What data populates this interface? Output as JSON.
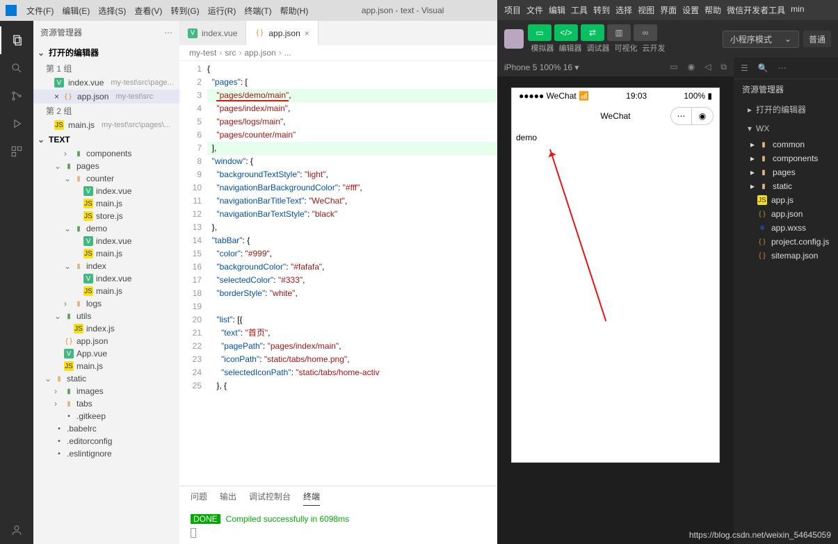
{
  "vscode": {
    "menus": [
      "文件(F)",
      "编辑(E)",
      "选择(S)",
      "查看(V)",
      "转到(G)",
      "运行(R)",
      "终端(T)",
      "帮助(H)"
    ],
    "title": "app.json - text - Visual",
    "explorer_title": "资源管理器",
    "section_open": "打开的编辑器",
    "group1": "第 1 组",
    "group2": "第 2 组",
    "open_editors": [
      {
        "icon": "vue",
        "name": "index.vue",
        "path": "my-test\\src\\page..."
      },
      {
        "icon": "json",
        "name": "app.json",
        "path": "my-test\\src",
        "sel": true,
        "pre": "×"
      },
      {
        "icon": "js",
        "name": "main.js",
        "path": "my-test\\src\\pages\\..."
      }
    ],
    "section_text": "TEXT",
    "tree": [
      {
        "d": 1,
        "chev": ">",
        "ico": "foldg",
        "t": "components"
      },
      {
        "d": 0,
        "chev": "v",
        "ico": "foldg",
        "t": "pages"
      },
      {
        "d": 1,
        "chev": "v",
        "ico": "fold",
        "t": "counter"
      },
      {
        "d": 2,
        "ico": "vue",
        "t": "index.vue"
      },
      {
        "d": 2,
        "ico": "js",
        "t": "main.js"
      },
      {
        "d": 2,
        "ico": "js",
        "t": "store.js"
      },
      {
        "d": 1,
        "chev": "v",
        "ico": "foldg",
        "t": "demo"
      },
      {
        "d": 2,
        "ico": "vue",
        "t": "index.vue"
      },
      {
        "d": 2,
        "ico": "js",
        "t": "main.js"
      },
      {
        "d": 1,
        "chev": "v",
        "ico": "fold",
        "t": "index"
      },
      {
        "d": 2,
        "ico": "vue",
        "t": "index.vue"
      },
      {
        "d": 2,
        "ico": "js",
        "t": "main.js"
      },
      {
        "d": 1,
        "chev": ">",
        "ico": "fold",
        "t": "logs"
      },
      {
        "d": 0,
        "chev": "v",
        "ico": "foldg",
        "t": "utils"
      },
      {
        "d": 1,
        "ico": "js",
        "t": "index.js"
      },
      {
        "d": 0,
        "ico": "json",
        "t": "app.json",
        "sel": true
      },
      {
        "d": 0,
        "ico": "vue",
        "t": "App.vue"
      },
      {
        "d": 0,
        "ico": "js",
        "t": "main.js"
      },
      {
        "d": -1,
        "chev": "v",
        "ico": "fold",
        "t": "static"
      },
      {
        "d": 0,
        "chev": ">",
        "ico": "foldg",
        "t": "images"
      },
      {
        "d": 0,
        "chev": ">",
        "ico": "fold",
        "t": "tabs"
      },
      {
        "d": 0,
        "ico": "",
        "t": ".gitkeep"
      },
      {
        "d": -1,
        "ico": "",
        "t": ".babelrc"
      },
      {
        "d": -1,
        "ico": "",
        "t": ".editorconfig"
      },
      {
        "d": -1,
        "ico": "",
        "t": ".eslintignore"
      }
    ],
    "tabs": [
      {
        "ico": "vue",
        "t": "index.vue"
      },
      {
        "ico": "json",
        "t": "app.json",
        "active": true
      }
    ],
    "crumbs": [
      "my-test",
      "src",
      "app.json",
      "..."
    ],
    "code": [
      {
        "n": 1,
        "h": "{"
      },
      {
        "n": 2,
        "h": "  <span class='tok-key'>\"pages\"</span>: ["
      },
      {
        "n": 3,
        "cls": "hl-add",
        "h": "    <span class='tok-str underline'>\"pages/demo/main\"</span>,"
      },
      {
        "n": 4,
        "h": "    <span class='tok-str'>\"pages/index/main\"</span>,"
      },
      {
        "n": 5,
        "h": "    <span class='tok-str'>\"pages/logs/main\"</span>,"
      },
      {
        "n": 6,
        "h": "    <span class='tok-str'>\"pages/counter/main\"</span>"
      },
      {
        "n": 7,
        "cls": "hl-add",
        "h": "  ],"
      },
      {
        "n": 8,
        "h": "  <span class='tok-key'>\"window\"</span>: {"
      },
      {
        "n": 9,
        "h": "    <span class='tok-key'>\"backgroundTextStyle\"</span>: <span class='tok-str'>\"light\"</span>,"
      },
      {
        "n": 10,
        "h": "    <span class='tok-key'>\"navigationBarBackgroundColor\"</span>: <span class='tok-str'>\"#fff\"</span>,"
      },
      {
        "n": 11,
        "h": "    <span class='tok-key'>\"navigationBarTitleText\"</span>: <span class='tok-str'>\"WeChat\"</span>,"
      },
      {
        "n": 12,
        "h": "    <span class='tok-key'>\"navigationBarTextStyle\"</span>: <span class='tok-str'>\"black\"</span>"
      },
      {
        "n": 13,
        "h": "  },"
      },
      {
        "n": 14,
        "h": "  <span class='tok-key'>\"tabBar\"</span>: {"
      },
      {
        "n": 15,
        "h": "    <span class='tok-key'>\"color\"</span>: <span class='tok-str'>\"#999\"</span>,"
      },
      {
        "n": 16,
        "h": "    <span class='tok-key'>\"backgroundColor\"</span>: <span class='tok-str'>\"#fafafa\"</span>,"
      },
      {
        "n": 17,
        "h": "    <span class='tok-key'>\"selectedColor\"</span>: <span class='tok-str'>\"#333\"</span>,"
      },
      {
        "n": 18,
        "h": "    <span class='tok-key'>\"borderStyle\"</span>: <span class='tok-str'>\"white\"</span>,"
      },
      {
        "n": 19,
        "h": ""
      },
      {
        "n": 20,
        "h": "    <span class='tok-key'>\"list\"</span>: [{"
      },
      {
        "n": 21,
        "h": "      <span class='tok-key'>\"text\"</span>: <span class='tok-str'>\"首页\"</span>,"
      },
      {
        "n": 22,
        "h": "      <span class='tok-key'>\"pagePath\"</span>: <span class='tok-str'>\"pages/index/main\"</span>,"
      },
      {
        "n": 23,
        "h": "      <span class='tok-key'>\"iconPath\"</span>: <span class='tok-str'>\"static/tabs/home.png\"</span>,"
      },
      {
        "n": 24,
        "h": "      <span class='tok-key'>\"selectedIconPath\"</span>: <span class='tok-str'>\"static/tabs/home-activ</span>"
      },
      {
        "n": 25,
        "h": "    }, {"
      }
    ],
    "panel": {
      "tabs": [
        "问题",
        "输出",
        "调试控制台",
        "终端"
      ],
      "active": 3,
      "done": "DONE",
      "msg": "Compiled successfully in 6098ms"
    }
  },
  "wx": {
    "menus": [
      "项目",
      "文件",
      "编辑",
      "工具",
      "转到",
      "选择",
      "视图",
      "界面",
      "设置",
      "帮助",
      "微信开发者工具",
      "min"
    ],
    "tool_labels": [
      "模拟器",
      "编辑器",
      "调试器",
      "可视化",
      "云开发"
    ],
    "mode": "小程序模式",
    "compile": "普通",
    "device": "iPhone 5 100% 16 ▾",
    "explorer": "资源管理器",
    "open": "打开的编辑器",
    "root": "WX",
    "folders": [
      "common",
      "components",
      "pages",
      "static"
    ],
    "files": [
      {
        "ico": "js",
        "t": "app.js"
      },
      {
        "ico": "json",
        "t": "app.json"
      },
      {
        "ico": "wxss",
        "t": "app.wxss"
      },
      {
        "ico": "json",
        "t": "project.config.js"
      },
      {
        "ico": "json",
        "t": "sitemap.json"
      }
    ],
    "phone": {
      "carrier": "●●●●● WeChat",
      "wifi": "📶",
      "time": "19:03",
      "batt": "100%",
      "title": "WeChat",
      "content": "demo"
    }
  },
  "watermark": "https://blog.csdn.net/weixin_54645059"
}
